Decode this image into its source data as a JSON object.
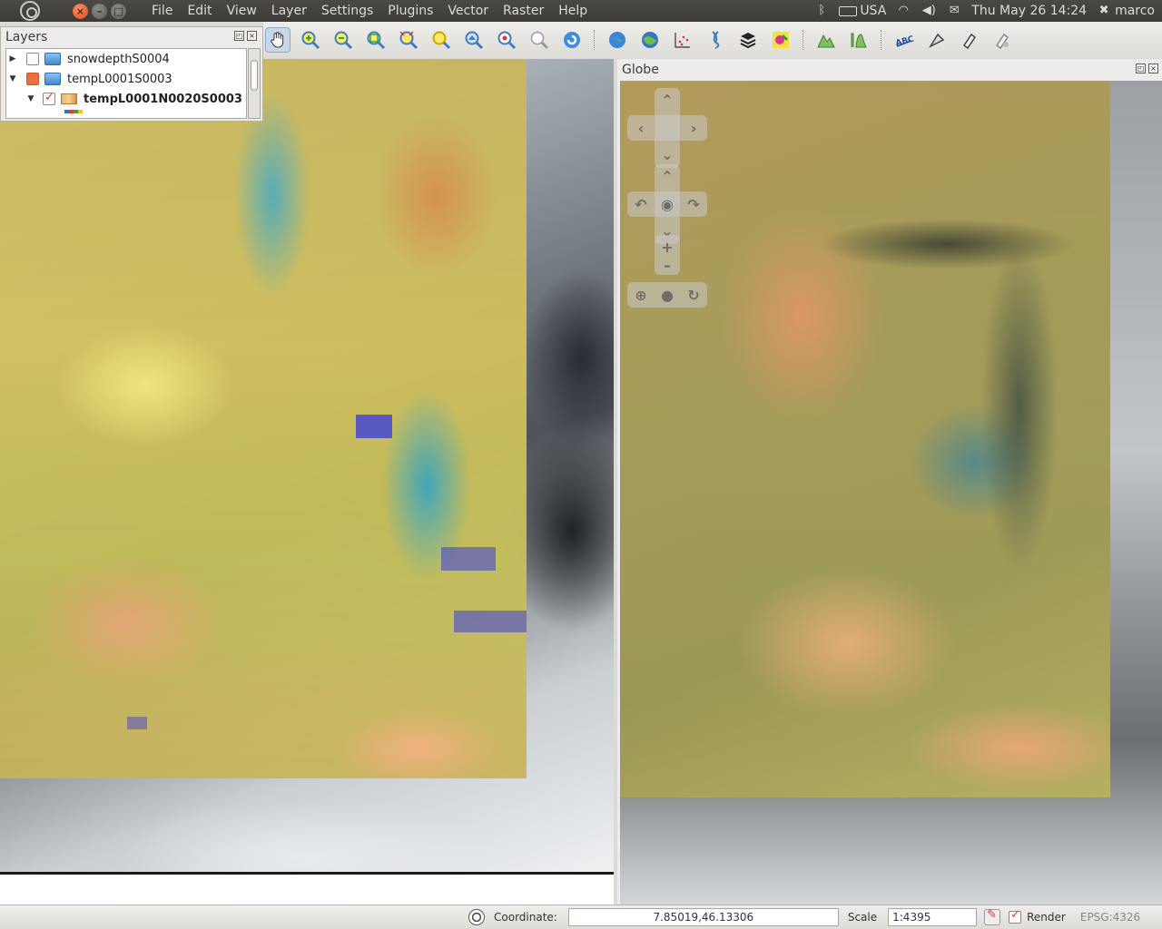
{
  "topbar": {
    "menus": [
      "File",
      "Edit",
      "View",
      "Layer",
      "Settings",
      "Plugins",
      "Vector",
      "Raster",
      "Help"
    ],
    "keyboard_layout": "USA",
    "datetime": "Thu May 26 14:24",
    "user": "marco"
  },
  "layers_panel": {
    "title": "Layers",
    "layers": [
      {
        "name": "snowdepthS0004",
        "expanded": false,
        "checked": "unchecked",
        "type": "group"
      },
      {
        "name": "tempL0001S0003",
        "expanded": true,
        "checked": "partial",
        "type": "group"
      },
      {
        "name": "tempL0001N0020S0003",
        "expanded": true,
        "checked": "checked",
        "type": "raster"
      }
    ]
  },
  "globe_panel": {
    "title": "Globe"
  },
  "statusbar": {
    "coordinate_label": "Coordinate:",
    "coordinate_value": "7.85019,46.13306",
    "scale_label": "Scale",
    "scale_value": "1:4395",
    "render_label": "Render",
    "crs": "EPSG:4326"
  },
  "toolbar": {
    "icons": [
      "pan-map-icon",
      "zoom-in-icon",
      "zoom-out-icon",
      "zoom-full-icon",
      "zoom-selection-icon",
      "zoom-layer-icon",
      "zoom-last-icon",
      "zoom-next-icon",
      "refresh-icon",
      "identify-icon",
      "globe-icon",
      "world-icon",
      "graph-icon",
      "dna-icon",
      "layers-stack-icon",
      "raster-calc-icon",
      "terrain-icon",
      "profile-icon",
      "label-icon",
      "node-tool-icon",
      "pin-icon",
      "pin-tool-icon"
    ]
  },
  "colors": {
    "accent": "#df4a16",
    "panel_bg": "#edeceb",
    "topbar_bg": "#3c3b37"
  }
}
